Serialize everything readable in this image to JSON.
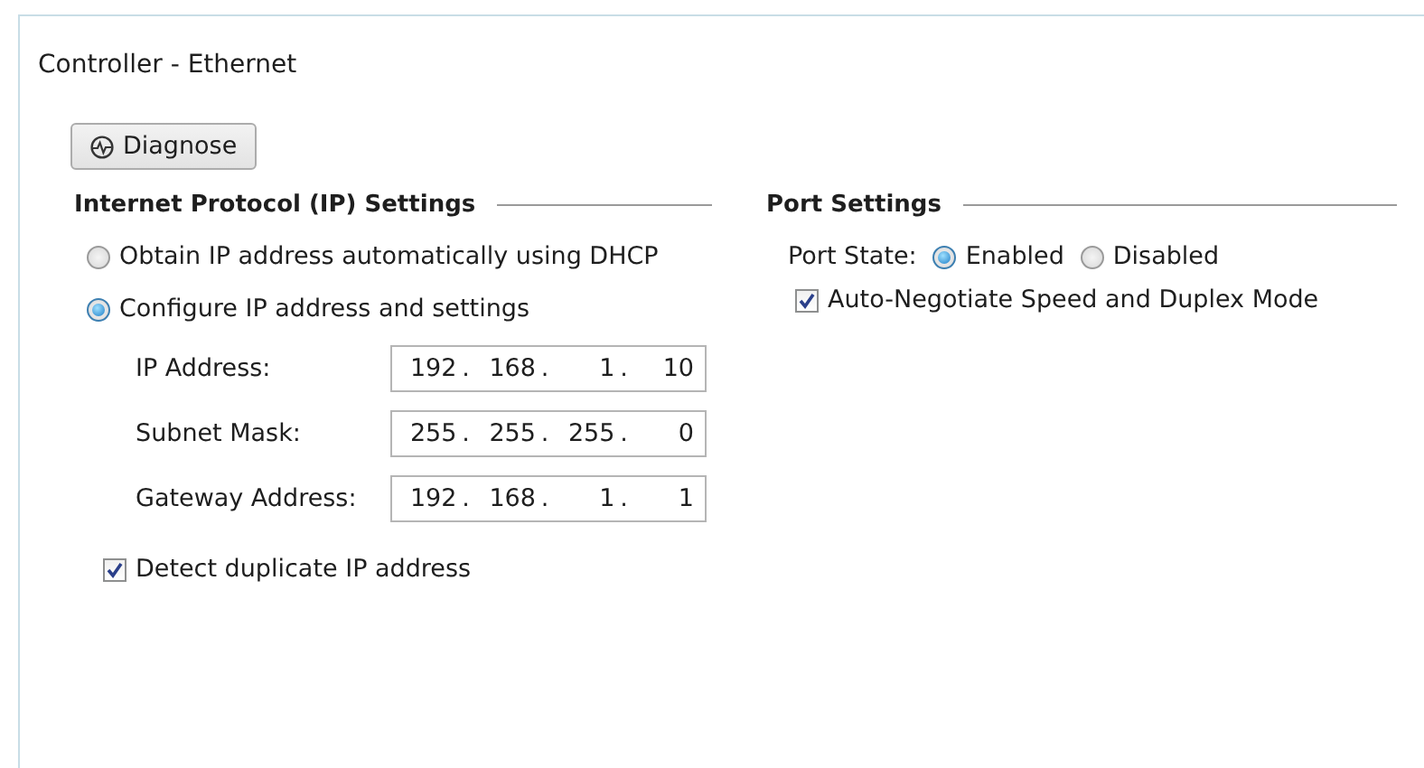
{
  "panel": {
    "title": "Controller - Ethernet"
  },
  "diagnose_button": {
    "label": "Diagnose"
  },
  "ip_settings": {
    "heading": "Internet Protocol (IP) Settings",
    "address_modes": [
      {
        "label": "Obtain IP address automatically using DHCP",
        "selected": false
      },
      {
        "label": "Configure IP address and settings",
        "selected": true
      }
    ],
    "separator": ".",
    "fields": [
      {
        "label": "IP Address:",
        "octets": [
          "192",
          "168",
          "1",
          "10"
        ]
      },
      {
        "label": "Subnet Mask:",
        "octets": [
          "255",
          "255",
          "255",
          "0"
        ]
      },
      {
        "label": "Gateway Address:",
        "octets": [
          "192",
          "168",
          "1",
          "1"
        ]
      }
    ],
    "detect_duplicate": {
      "label": "Detect duplicate IP address",
      "checked": true
    }
  },
  "port_settings": {
    "heading": "Port Settings",
    "port_state_label": "Port State:",
    "port_states": [
      {
        "label": "Enabled",
        "selected": true
      },
      {
        "label": "Disabled",
        "selected": false
      }
    ],
    "auto_negotiate": {
      "label": "Auto-Negotiate Speed and Duplex Mode",
      "checked": true
    }
  }
}
